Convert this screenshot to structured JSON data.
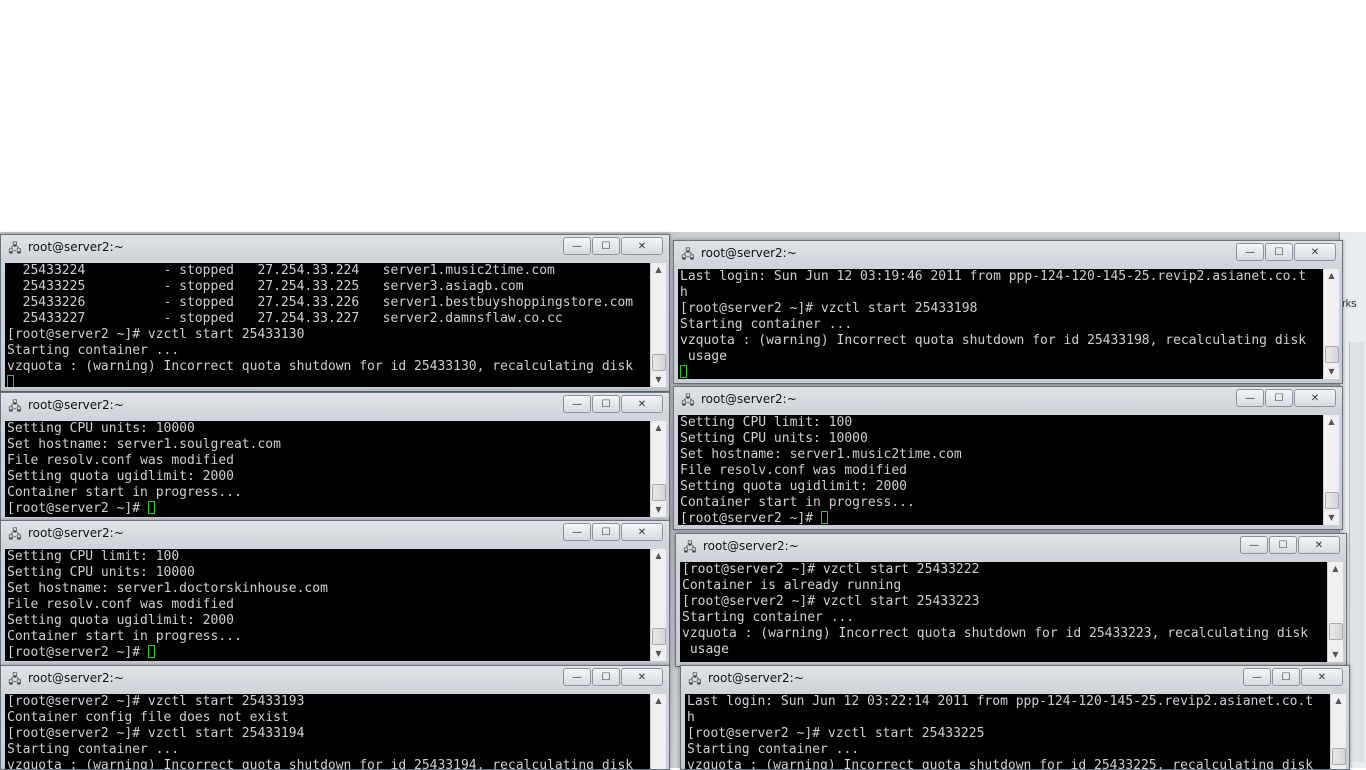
{
  "windows": [
    {
      "title": "root@server2:~",
      "lines": [
        "  25433224          - stopped   27.254.33.224   server1.music2time.com",
        "  25433225          - stopped   27.254.33.225   server3.asiagb.com",
        "  25433226          - stopped   27.254.33.226   server1.bestbuyshoppingstore.com",
        "  25433227          - stopped   27.254.33.227   server2.damnsflaw.co.cc",
        "[root@server2 ~]# vzctl start 25433130",
        "Starting container ...",
        "vzquota : (warning) Incorrect quota shutdown for id 25433130, recalculating disk"
      ],
      "prompt": ""
    },
    {
      "title": "root@server2:~",
      "lines": [
        "Setting CPU units: 10000",
        "Set hostname: server1.soulgreat.com",
        "File resolv.conf was modified",
        "Setting quota ugidlimit: 2000",
        "Container start in progress..."
      ],
      "prompt": "[root@server2 ~]# "
    },
    {
      "title": "root@server2:~",
      "lines": [
        "Setting CPU limit: 100",
        "Setting CPU units: 10000",
        "Set hostname: server1.doctorskinhouse.com",
        "File resolv.conf was modified",
        "Setting quota ugidlimit: 2000",
        "Container start in progress..."
      ],
      "prompt": "[root@server2 ~]# "
    },
    {
      "title": "root@server2:~",
      "lines": [
        "[root@server2 ~]# vzctl start 25433193",
        "Container config file does not exist",
        "[root@server2 ~]# vzctl start 25433194",
        "Starting container ...",
        "vzquota : (warning) Incorrect quota shutdown for id 25433194, recalculating disk"
      ],
      "prompt": ""
    },
    {
      "title": "root@server2:~",
      "lines": [
        "Last login: Sun Jun 12 03:19:46 2011 from ppp-124-120-145-25.revip2.asianet.co.t",
        "h",
        "[root@server2 ~]# vzctl start 25433198",
        "Starting container ...",
        "vzquota : (warning) Incorrect quota shutdown for id 25433198, recalculating disk",
        " usage"
      ],
      "prompt": ""
    },
    {
      "title": "root@server2:~",
      "lines": [
        "Setting CPU limit: 100",
        "Setting CPU units: 10000",
        "Set hostname: server1.music2time.com",
        "File resolv.conf was modified",
        "Setting quota ugidlimit: 2000",
        "Container start in progress..."
      ],
      "prompt": "[root@server2 ~]# "
    },
    {
      "title": "root@server2:~",
      "lines": [
        "[root@server2 ~]# vzctl start 25433222",
        "Container is already running",
        "[root@server2 ~]# vzctl start 25433223",
        "Starting container ...",
        "vzquota : (warning) Incorrect quota shutdown for id 25433223, recalculating disk",
        " usage"
      ],
      "prompt": ""
    },
    {
      "title": "root@server2:~",
      "lines": [
        "Last login: Sun Jun 12 03:22:14 2011 from ppp-124-120-145-25.revip2.asianet.co.t",
        "h",
        "[root@server2 ~]# vzctl start 25433225",
        "Starting container ...",
        "vzquota : (warning) Incorrect quota shutdown for id 25433225, recalculating disk"
      ],
      "prompt": ""
    }
  ],
  "buttons": {
    "minimize": "—",
    "maximize": "☐",
    "close": "✕"
  },
  "background_fragment": "rks",
  "colors": {
    "terminal_bg": "#000000",
    "terminal_fg": "#d0d0d0",
    "cursor": "#25c825"
  },
  "icons": {
    "window": "putty-icon"
  }
}
